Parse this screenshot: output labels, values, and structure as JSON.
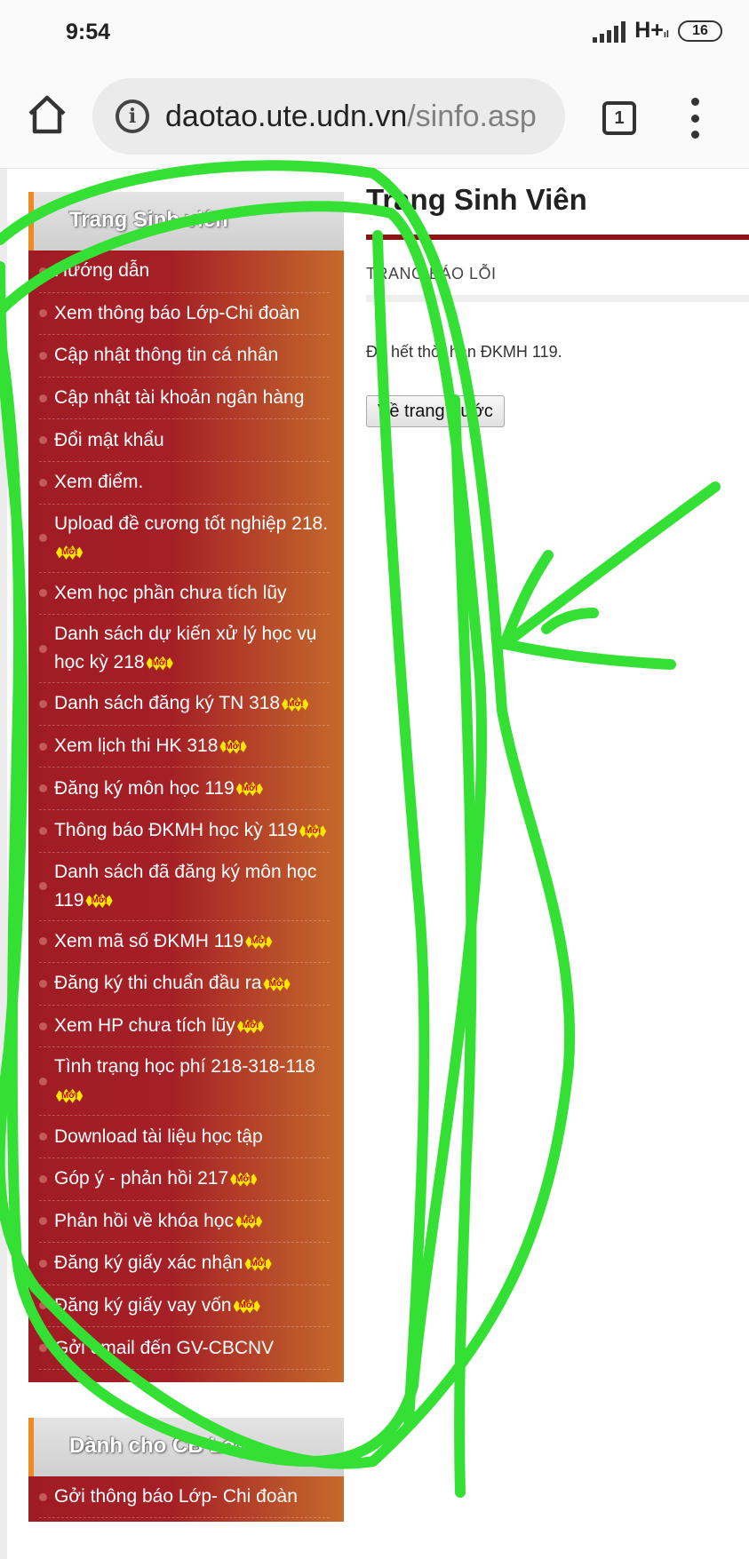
{
  "status_bar": {
    "time": "9:54",
    "network": "H+",
    "network_sub": "ıl",
    "battery": "16"
  },
  "browser": {
    "url_host": "daotao.ute.udn.vn",
    "url_path": "/sinfo.asp",
    "tab_count": "1",
    "icons": [
      "home-icon",
      "info-icon",
      "tabs-icon",
      "more-vert-icon"
    ]
  },
  "sidebar": {
    "header": "Trang Sinh viên",
    "badge": "Mới",
    "items": [
      {
        "label": "Hướng dẫn",
        "badge": ""
      },
      {
        "label": "Xem thông báo Lớp-Chi đoàn",
        "badge": ""
      },
      {
        "label": "Cập nhật thông tin cá nhân",
        "badge": ""
      },
      {
        "label": "Cập nhật tài khoản ngân hàng",
        "badge": ""
      },
      {
        "label": "Đổi mật khẩu",
        "badge": ""
      },
      {
        "label": "Xem điểm.",
        "badge": ""
      },
      {
        "label": "Upload đề cương tốt nghiệp 218.",
        "badge": "Mới"
      },
      {
        "label": "Xem học phần chưa tích lũy",
        "badge": ""
      },
      {
        "label": "Danh sách dự kiến xử lý học vụ học kỳ 218",
        "badge": "Mới"
      },
      {
        "label": "Danh sách đăng ký TN 318",
        "badge": "Mới"
      },
      {
        "label": "Xem lịch thi HK 318",
        "badge": "Mới"
      },
      {
        "label": "Đăng ký môn học 119",
        "badge": "Mới"
      },
      {
        "label": "Thông báo ĐKMH học kỳ 119",
        "badge": "Mới"
      },
      {
        "label": "Danh sách đã đăng ký môn học 119",
        "badge": "Mới"
      },
      {
        "label": "Xem mã số ĐKMH 119",
        "badge": "Mới"
      },
      {
        "label": "Đăng ký thi chuẩn đầu ra",
        "badge": "Mới"
      },
      {
        "label": "Xem HP chưa tích lũy",
        "badge": "Mới"
      },
      {
        "label": "Tình trạng học phí 218-318-118",
        "badge": "Mới"
      },
      {
        "label": "Download tài liệu học tập",
        "badge": ""
      },
      {
        "label": "Góp ý - phản hồi 217",
        "badge": "Mới"
      },
      {
        "label": "Phản hồi về khóa học",
        "badge": "Mới"
      },
      {
        "label": "Đăng ký giấy xác nhận",
        "badge": "Mới"
      },
      {
        "label": "Đăng ký giấy vay vốn",
        "badge": "Mới"
      },
      {
        "label": "Gởi email đến GV-CBCNV",
        "badge": ""
      }
    ]
  },
  "sidebar2": {
    "header": "Dành cho CB Lớp",
    "items": [
      {
        "label": "Gởi thông báo Lớp- Chi đoàn"
      }
    ]
  },
  "main": {
    "title": "Trang Sinh Viên",
    "section_title": "TRANG BÁO LỖI",
    "error_message": "Đã hết thời hạn ĐKMH 119.",
    "back_button": "Về trang trước"
  },
  "annotation": {
    "color": "#33e033"
  }
}
